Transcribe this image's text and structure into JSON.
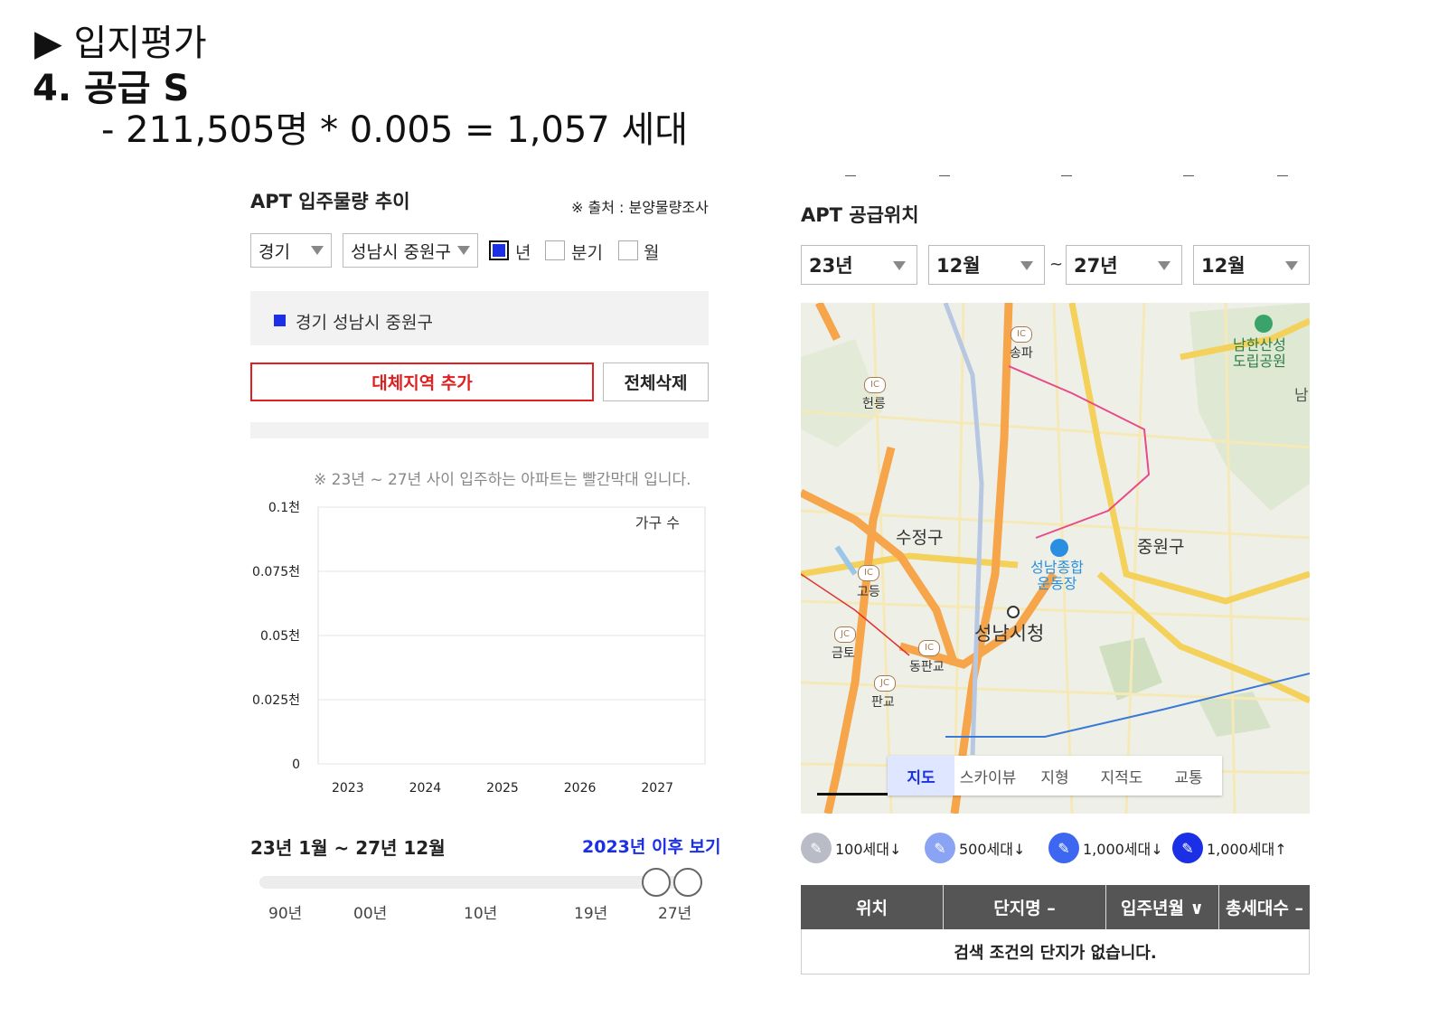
{
  "header": {
    "line1": "▶ 입지평가",
    "line2": "4.  공급 S",
    "line3": "- 211,505명 * 0.005 = 1,057 세대"
  },
  "left_panel": {
    "title": "APT 입주물량 추이",
    "source": "※ 출처 : 분양물량조사",
    "province_select": "경기",
    "district_select": "성남시 중원구",
    "period_options": [
      {
        "label": "년",
        "checked": true
      },
      {
        "label": "분기",
        "checked": false
      },
      {
        "label": "월",
        "checked": false
      }
    ],
    "region_item": "경기 성남시 중원구",
    "add_region_button": "대체지역 추가",
    "delete_all_button": "전체삭제",
    "note": "※ 23년 ~ 27년 사이 입주하는 아파트는 빨간막대 입니다.",
    "period_label": "23년 1월 ~ 27년 12월",
    "after_link": "2023년 이후 보기",
    "slider_labels": [
      "90년",
      "00년",
      "10년",
      "19년",
      "27년"
    ]
  },
  "chart_data": {
    "type": "bar",
    "categories": [
      "2023",
      "2024",
      "2025",
      "2026",
      "2027"
    ],
    "values": [
      0,
      0,
      0,
      0,
      0
    ],
    "legend": "가구 수",
    "yticks": [
      "0.1천",
      "0.075천",
      "0.05천",
      "0.025천",
      "0"
    ],
    "ylim": [
      0,
      0.1
    ],
    "grid": true
  },
  "right_panel": {
    "title": "APT 공급위치",
    "from_year": "23년",
    "from_month": "12월",
    "range_sep": "~",
    "to_year": "27년",
    "to_month": "12월",
    "map": {
      "labels": {
        "sujeong": "수정구",
        "jungwon": "중원구",
        "cityhall": "성남시청",
        "stadium": "성남종합\n운동장",
        "namhansanseong": "남한산성\n도립공원",
        "nam": "남",
        "songpa": "송파",
        "heolleung": "헌릉",
        "godeung": "고등",
        "geumto": "금토",
        "dongpangyo": "동판교",
        "pangyo": "판교",
        "ic": "IC",
        "jc": "JC"
      },
      "tabs": [
        "지도",
        "스카이뷰",
        "지형",
        "지적도",
        "교통"
      ],
      "active_tab": "지도"
    },
    "legend": [
      "100세대↓",
      "500세대↓",
      "1,000세대↓",
      "1,000세대↑"
    ],
    "legend_colors": [
      "#b9bcc6",
      "#8aa3f2",
      "#3d67f0",
      "#1a2fe6"
    ],
    "table": {
      "headers": [
        "위치",
        "단지명 –",
        "입주년월 ∨",
        "총세대수 –"
      ],
      "empty_message": "검색 조건의 단지가 없습니다."
    }
  }
}
